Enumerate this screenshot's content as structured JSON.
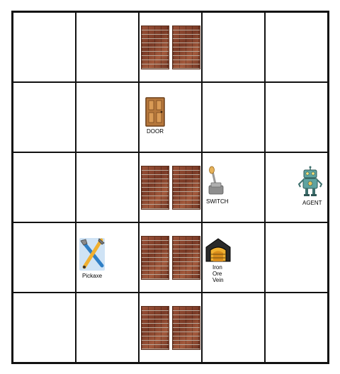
{
  "grid": {
    "rows": 5,
    "cols": 5
  },
  "walls": [
    {
      "row": 0,
      "col": 2
    },
    {
      "row": 2,
      "col": 2
    },
    {
      "row": 3,
      "col": 2
    },
    {
      "row": 4,
      "col": 2
    }
  ],
  "objects": {
    "door": {
      "row": 1,
      "col": 2,
      "label": "DOOR",
      "icon": "door-icon"
    },
    "switch": {
      "row": 2,
      "col": 3,
      "label": "SWITCH",
      "icon": "lever-switch-icon"
    },
    "agent": {
      "row": 2,
      "col": 4,
      "label": "AGENT",
      "icon": "robot-icon"
    },
    "pickaxe": {
      "row": 3,
      "col": 1,
      "label": "Pickaxe",
      "icon": "tools-icon"
    },
    "iron_ore_vein": {
      "row": 3,
      "col": 3,
      "label_lines": [
        "Iron",
        "Ore",
        "Vein"
      ],
      "icon": "mine-icon"
    }
  },
  "colors": {
    "grid_line": "#111111",
    "brick": "#8a4a32",
    "door": "#b5773c",
    "robot": "#5fa3a0"
  }
}
